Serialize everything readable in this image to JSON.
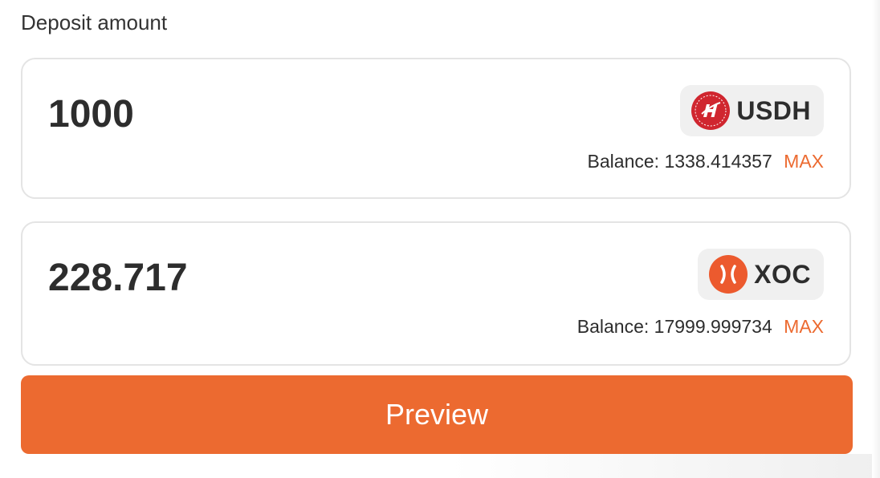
{
  "deposit": {
    "label": "Deposit amount",
    "accent_color": "#ec6a30",
    "inputs": [
      {
        "value": "1000",
        "token": {
          "symbol": "USDH",
          "icon": "usdh-token-icon",
          "icon_color": "#d0262f"
        },
        "balance_label": "Balance:",
        "balance_value": "1338.414357",
        "max_label": "MAX"
      },
      {
        "value": "228.717",
        "token": {
          "symbol": "XOC",
          "icon": "xoc-token-icon",
          "icon_color": "#ec5a2e"
        },
        "balance_label": "Balance:",
        "balance_value": "17999.999734",
        "max_label": "MAX"
      }
    ],
    "preview_label": "Preview"
  }
}
